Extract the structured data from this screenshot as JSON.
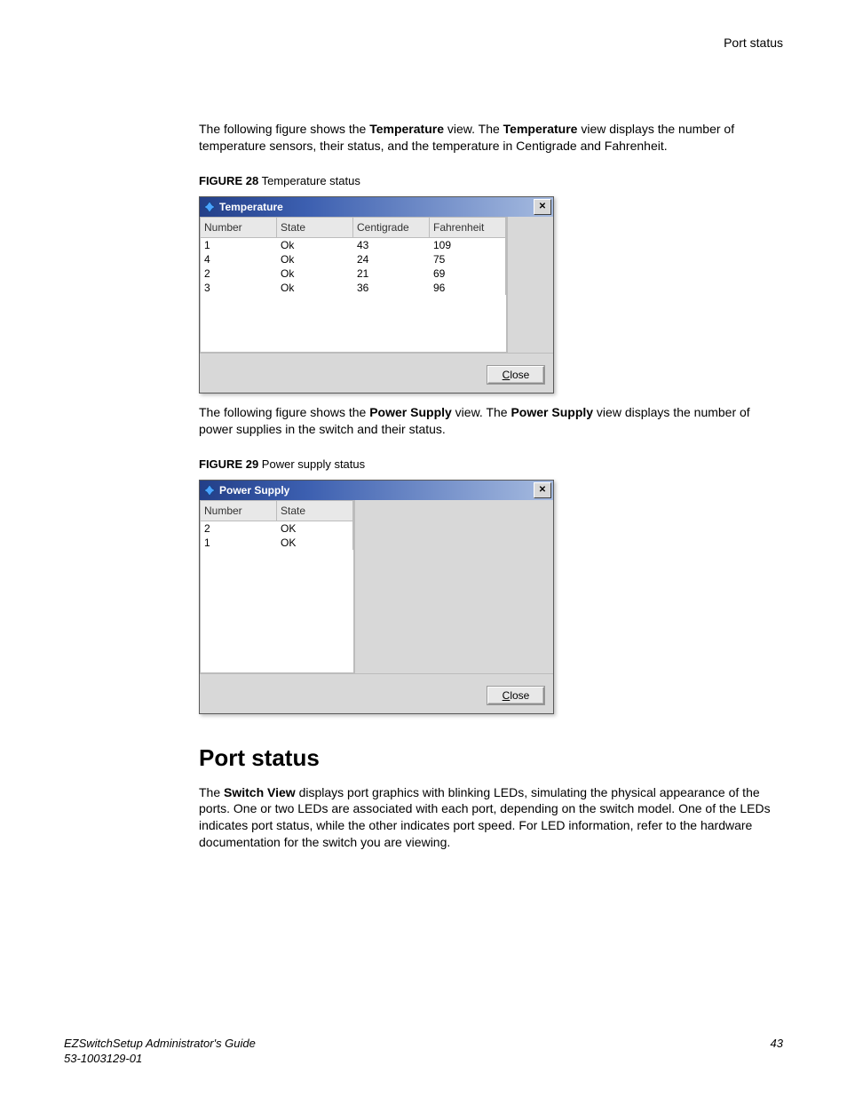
{
  "header": {
    "running_head": "Port status"
  },
  "intro1": {
    "pre": "The following figure shows the ",
    "b1": "Temperature",
    "mid": " view. The ",
    "b2": "Temperature",
    "post": " view displays the number of temperature sensors, their status, and the temperature in Centigrade and Fahrenheit."
  },
  "figure28": {
    "label_bold": "FIGURE 28",
    "label_rest": " Temperature status"
  },
  "dialog1": {
    "title": "Temperature",
    "close_button": "Close",
    "columns": [
      "Number",
      "State",
      "Centigrade",
      "Fahrenheit"
    ],
    "rows": [
      {
        "number": "1",
        "state": "Ok",
        "centigrade": "43",
        "fahrenheit": "109"
      },
      {
        "number": "4",
        "state": "Ok",
        "centigrade": "24",
        "fahrenheit": "75"
      },
      {
        "number": "2",
        "state": "Ok",
        "centigrade": "21",
        "fahrenheit": "69"
      },
      {
        "number": "3",
        "state": "Ok",
        "centigrade": "36",
        "fahrenheit": "96"
      }
    ]
  },
  "intro2": {
    "pre": "The following figure shows the ",
    "b1": "Power Supply",
    "mid": " view. The ",
    "b2": "Power Supply",
    "post": " view displays the number of power supplies in the switch and their status."
  },
  "figure29": {
    "label_bold": "FIGURE 29",
    "label_rest": " Power supply status"
  },
  "dialog2": {
    "title": "Power Supply",
    "close_button": "Close",
    "columns": [
      "Number",
      "State"
    ],
    "rows": [
      {
        "number": "2",
        "state": "OK"
      },
      {
        "number": "1",
        "state": "OK"
      }
    ]
  },
  "section": {
    "heading": "Port status",
    "para_pre": "The ",
    "para_b": "Switch View",
    "para_post": " displays port graphics with blinking LEDs, simulating the physical appearance of the ports. One or two LEDs are associated with each port, depending on the switch model. One of the LEDs indicates port status, while the other indicates port speed. For LED information, refer to the hardware documentation for the switch you are viewing."
  },
  "footer": {
    "guide": "EZSwitchSetup Administrator's Guide",
    "doc_number": "53-1003129-01",
    "page": "43"
  }
}
